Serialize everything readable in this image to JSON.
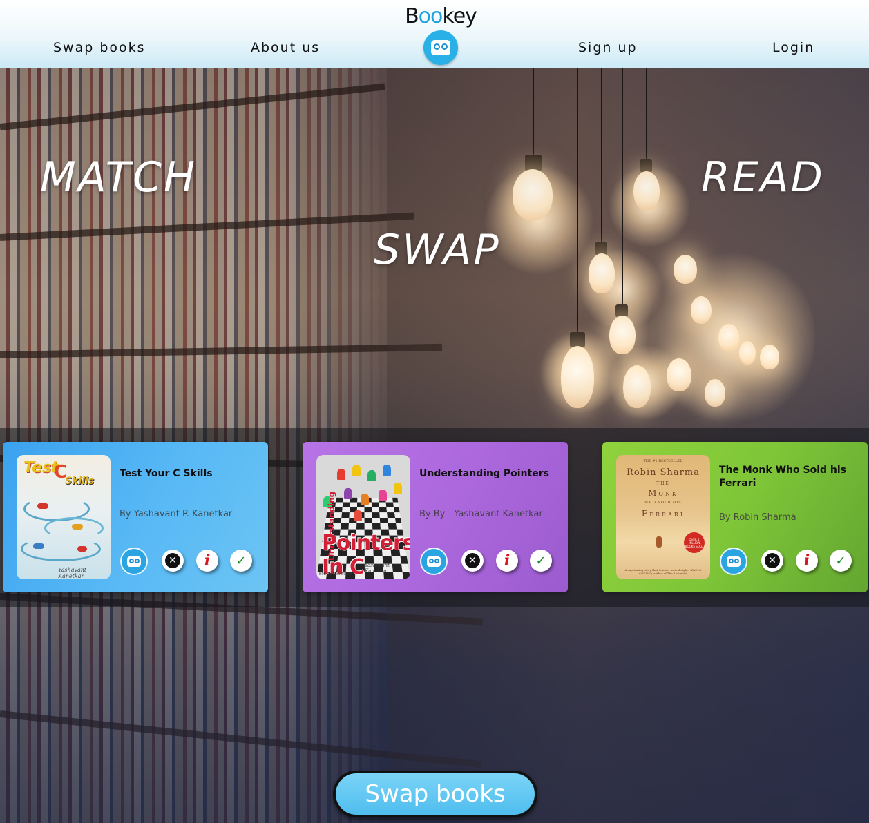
{
  "header": {
    "brand": {
      "b": "B",
      "o1": "o",
      "o2": "o",
      "rest": "key"
    },
    "nav": {
      "swap_books": "Swap books",
      "about_us": "About us",
      "sign_up": "Sign up",
      "login": "Login"
    },
    "logo_icon": "bookey-logo-icon"
  },
  "hero": {
    "word1": "MATCH",
    "word2": "SWAP",
    "word3": "READ"
  },
  "cards": [
    {
      "title": "Test Your C Skills",
      "author": "By Yashavant P. Kanetkar",
      "cover_text": {
        "line1": "Test",
        "line2": "C",
        "line3": "Skills",
        "author": "Yashavant Kanetkar"
      },
      "color": "#4aaff2"
    },
    {
      "title": "Understanding Pointers",
      "author": "By By - Yashavant Kanetkar",
      "cover_text": {
        "vertical": "Understanding",
        "big": "Pointers In C",
        "author": "Yashavant Kanetkar",
        "publisher": "BPB PUBLICATIONS"
      },
      "color": "#a968db"
    },
    {
      "title": "The Monk Who Sold his Ferrari",
      "author": "By Robin Sharma",
      "cover_text": {
        "top": "THE #1 BESTSELLER",
        "author": "Robin Sharma",
        "the": "THE",
        "monk": "Monk",
        "who": "WHO SOLD HIS",
        "ferrari": "Ferrari",
        "sticker": "OVER 4 MILLION BOOKS SOLD",
        "blurb": "A captivating story that teaches us to delight... PAULO COELHO, author of The Alchemist"
      },
      "color": "#7fc638"
    }
  ],
  "actions": {
    "swap": "swap-book-icon",
    "reject": "✕",
    "info": "i",
    "accept": "✓"
  },
  "cta": {
    "label": "Swap books"
  }
}
